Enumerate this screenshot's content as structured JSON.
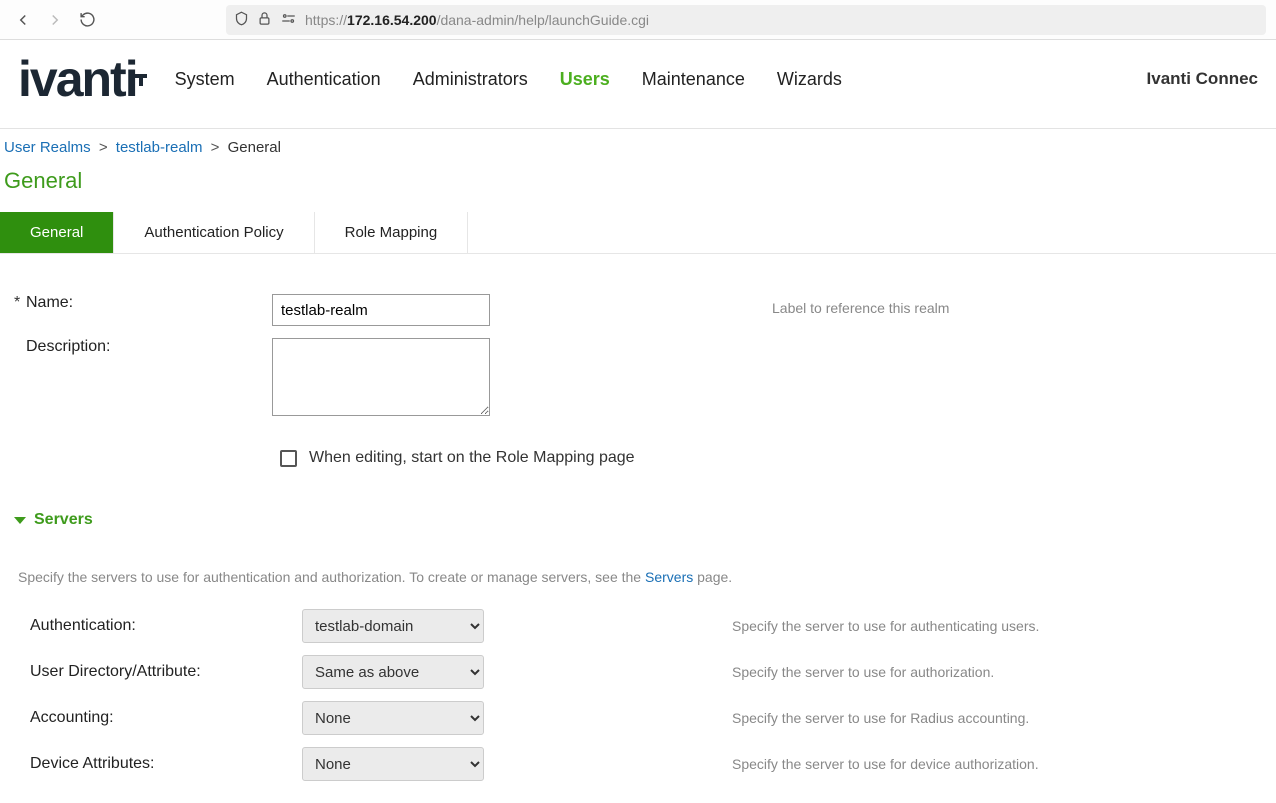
{
  "browser": {
    "url_prefix": "https://",
    "url_host": "172.16.54.200",
    "url_path": "/dana-admin/help/launchGuide.cgi"
  },
  "header": {
    "logo_text": "ivanti",
    "product": "Ivanti Connec",
    "nav": [
      "System",
      "Authentication",
      "Administrators",
      "Users",
      "Maintenance",
      "Wizards"
    ],
    "nav_active": "Users"
  },
  "breadcrumbs": {
    "items": [
      {
        "label": "User Realms",
        "link": true
      },
      {
        "label": "testlab-realm",
        "link": true
      },
      {
        "label": "General",
        "link": false
      }
    ]
  },
  "page_title": "General",
  "tabs": {
    "items": [
      "General",
      "Authentication Policy",
      "Role Mapping"
    ],
    "active": "General"
  },
  "form": {
    "name_label": "Name:",
    "name_value": "testlab-realm",
    "name_help": "Label to reference this realm",
    "desc_label": "Description:",
    "desc_value": "",
    "start_on_rm_label": "When editing, start on the Role Mapping page"
  },
  "servers_section": {
    "title": "Servers",
    "desc_pre": "Specify the servers to use for authentication and authorization. To create or manage servers, see the ",
    "desc_link": "Servers",
    "desc_post": " page.",
    "rows": [
      {
        "label": "Authentication:",
        "value": "testlab-domain",
        "help": "Specify the server to use for authenticating users."
      },
      {
        "label": "User Directory/Attribute:",
        "value": "Same as above",
        "help": "Specify the server to use for authorization."
      },
      {
        "label": "Accounting:",
        "value": "None",
        "help": "Specify the server to use for Radius accounting."
      },
      {
        "label": "Device Attributes:",
        "value": "None",
        "help": "Specify the server to use for device authorization."
      }
    ]
  }
}
